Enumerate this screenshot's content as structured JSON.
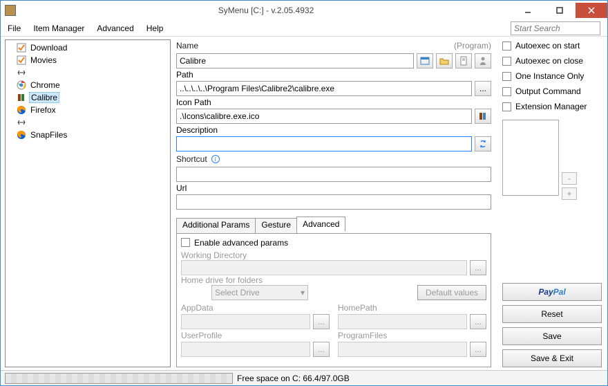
{
  "title": "SyMenu [C:] - v.2.05.4932",
  "menubar": [
    "File",
    "Item Manager",
    "Advanced",
    "Help"
  ],
  "search_placeholder": "Start Search",
  "tree": [
    {
      "icon": "check-orange",
      "label": "Download"
    },
    {
      "icon": "check-orange",
      "label": "Movies"
    },
    {
      "icon": "sep",
      "label": "<Separator>"
    },
    {
      "icon": "chrome",
      "label": "Chrome"
    },
    {
      "icon": "calibre",
      "label": "Calibre",
      "selected": true
    },
    {
      "icon": "firefox",
      "label": "Firefox"
    },
    {
      "icon": "sep",
      "label": "<Separator>"
    },
    {
      "icon": "snap",
      "label": "SnapFiles"
    }
  ],
  "labels": {
    "name": "Name",
    "program": "(Program)",
    "path": "Path",
    "iconpath": "Icon Path",
    "description": "Description",
    "shortcut": "Shortcut",
    "url": "Url"
  },
  "fields": {
    "name": "Calibre",
    "path": "..\\..\\..\\..\\Program Files\\Calibre2\\calibre.exe",
    "iconpath": ".\\Icons\\calibre.exe.ico",
    "description": "",
    "shortcut": "",
    "url": ""
  },
  "tabs": [
    "Additional Params",
    "Gesture",
    "Advanced"
  ],
  "active_tab": 2,
  "advanced": {
    "enable": "Enable advanced params",
    "workdir": "Working Directory",
    "homedrive": "Home drive for folders",
    "selectdrive": "Select Drive",
    "defaultvalues": "Default values",
    "appdata": "AppData",
    "homepath": "HomePath",
    "userprofile": "UserProfile",
    "programfiles": "ProgramFiles"
  },
  "right_checks": [
    "Autoexec on start",
    "Autoexec on close",
    "One Instance Only",
    "Output Command",
    "Extension Manager"
  ],
  "buttons": {
    "reset": "Reset",
    "save": "Save",
    "saveexit": "Save & Exit"
  },
  "status": "Free space on C: 66.4/97.0GB"
}
